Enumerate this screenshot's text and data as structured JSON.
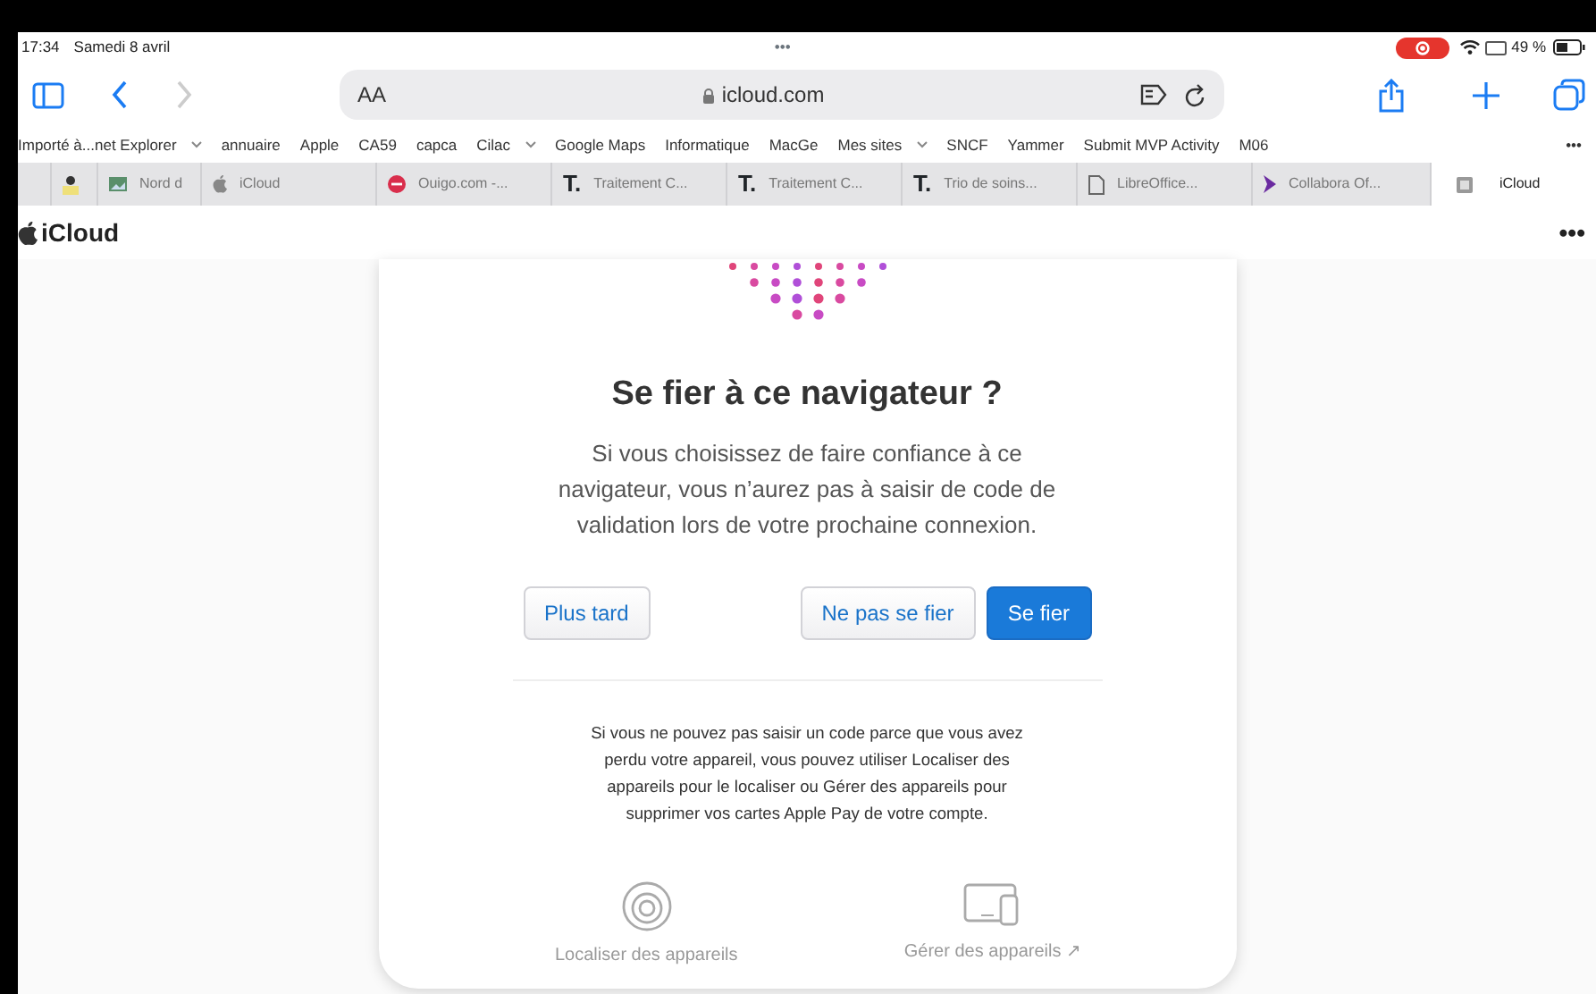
{
  "status_bar": {
    "time": "17:34",
    "date": "Samedi 8 avril",
    "handle": "•••",
    "battery": "49 %"
  },
  "toolbar": {
    "text_size": "AA",
    "address": "icloud.com",
    "back_disabled": false,
    "forward_disabled": true
  },
  "bookmarks": [
    {
      "label": "Importé à...net Explorer",
      "folder": true
    },
    {
      "label": "annuaire",
      "folder": false
    },
    {
      "label": "Apple",
      "folder": false
    },
    {
      "label": "CA59",
      "folder": false
    },
    {
      "label": "capca",
      "folder": false
    },
    {
      "label": "Cilac",
      "folder": true
    },
    {
      "label": "Google Maps",
      "folder": false
    },
    {
      "label": "Informatique",
      "folder": false
    },
    {
      "label": "MacGe",
      "folder": false
    },
    {
      "label": "Mes sites",
      "folder": true
    },
    {
      "label": "SNCF",
      "folder": false
    },
    {
      "label": "Yammer",
      "folder": false
    },
    {
      "label": "Submit MVP Activity",
      "folder": false
    },
    {
      "label": "M06",
      "folder": false
    }
  ],
  "bookmarks_more": "•••",
  "tabs": [
    {
      "kind": "figure",
      "selected": false
    },
    {
      "kind": "image",
      "title": "Nord d",
      "selected": false
    },
    {
      "kind": "apple",
      "title": "iCloud",
      "selected": false
    },
    {
      "kind": "dot",
      "title": "Ouigo.com -...",
      "selected": false
    },
    {
      "kind": "letter",
      "glyph": "T.",
      "title": "Traitement C...",
      "selected": false
    },
    {
      "kind": "letter",
      "glyph": "T.",
      "title": "Traitement C...",
      "selected": false
    },
    {
      "kind": "letter",
      "glyph": "T.",
      "title": "Trio de soins...",
      "selected": false
    },
    {
      "kind": "document",
      "title": "LibreOffice...",
      "selected": false
    },
    {
      "kind": "chevron",
      "title": "Collabora Of...",
      "selected": false
    },
    {
      "kind": "square",
      "title": "iCloud",
      "selected": true
    }
  ],
  "page": {
    "brand": "iCloud",
    "more": "•••",
    "dialog": {
      "title": "Se fier à ce navigateur ?",
      "message": "Si vous choisissez de faire confiance à ce navigateur, vous n’aurez pas à saisir de code de validation lors de votre prochaine connexion.",
      "later_button": "Plus tard",
      "buttons": [
        {
          "label": "Ne pas se fier",
          "kind": "secondary"
        },
        {
          "label": "Se fier",
          "kind": "primary"
        }
      ],
      "help": "Si vous ne pouvez pas saisir un code parce que vous avez perdu votre appareil, vous pouvez utiliser Localiser des appareils pour le localiser ou Gérer des appareils pour supprimer vos cartes Apple Pay de votre compte.",
      "links": [
        {
          "kind": "locate",
          "label": "Localiser des appareils"
        },
        {
          "kind": "devices",
          "label": "Gérer des appareils ↗"
        }
      ]
    }
  }
}
